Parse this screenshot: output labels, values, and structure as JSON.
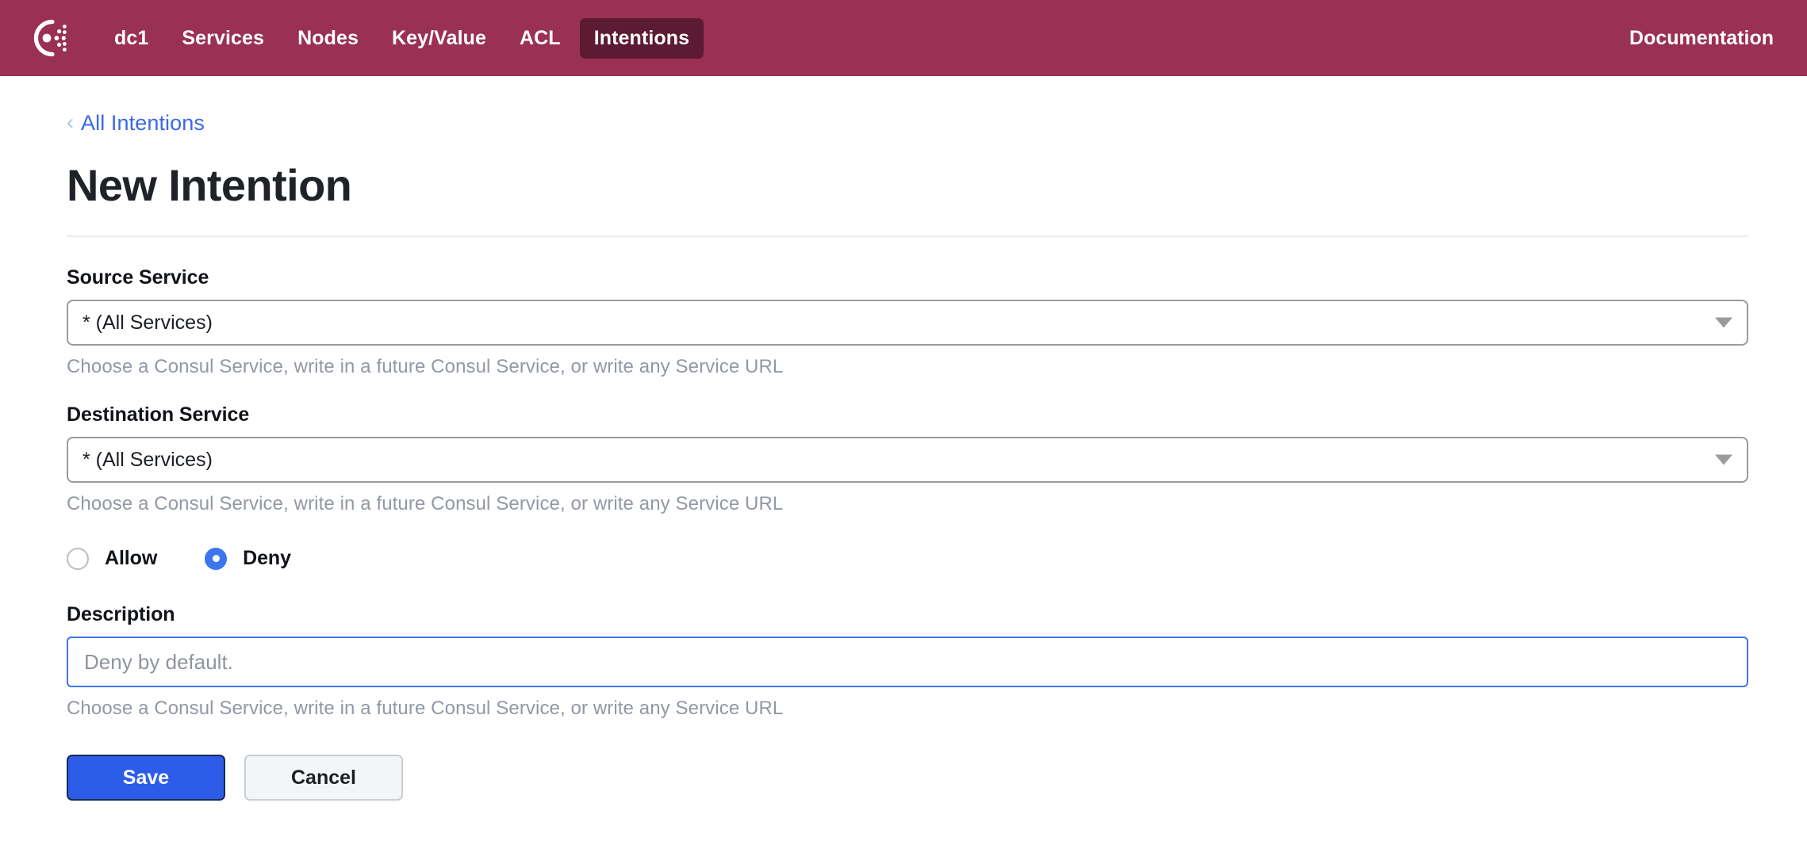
{
  "nav": {
    "logo_icon": "consul-logo-icon",
    "items": [
      {
        "label": "dc1",
        "active": false
      },
      {
        "label": "Services",
        "active": false
      },
      {
        "label": "Nodes",
        "active": false
      },
      {
        "label": "Key/Value",
        "active": false
      },
      {
        "label": "ACL",
        "active": false
      },
      {
        "label": "Intentions",
        "active": true
      }
    ],
    "documentation_label": "Documentation",
    "background_color": "#9a3054",
    "active_tab_color": "#5c1a33"
  },
  "breadcrumb": {
    "chevron_icon": "chevron-left-icon",
    "label": "All Intentions",
    "color": "#3b68e8"
  },
  "page": {
    "title": "New Intention"
  },
  "form": {
    "source": {
      "label": "Source Service",
      "value": "* (All Services)",
      "helper": "Choose a Consul Service, write in a future Consul Service, or write any Service URL",
      "dropdown_icon": "chevron-down-icon"
    },
    "destination": {
      "label": "Destination Service",
      "value": "* (All Services)",
      "helper": "Choose a Consul Service, write in a future Consul Service, or write any Service URL",
      "dropdown_icon": "chevron-down-icon"
    },
    "action": {
      "options": [
        {
          "label": "Allow",
          "selected": false
        },
        {
          "label": "Deny",
          "selected": true
        }
      ],
      "selected_color": "#3b76ee"
    },
    "description": {
      "label": "Description",
      "value": "",
      "placeholder": "Deny by default.",
      "helper": "Choose a Consul Service, write in a future Consul Service, or write any Service URL",
      "focused": true,
      "focus_color": "#3b76ee"
    },
    "buttons": {
      "save_label": "Save",
      "cancel_label": "Cancel",
      "save_color": "#2c5ce8"
    }
  }
}
